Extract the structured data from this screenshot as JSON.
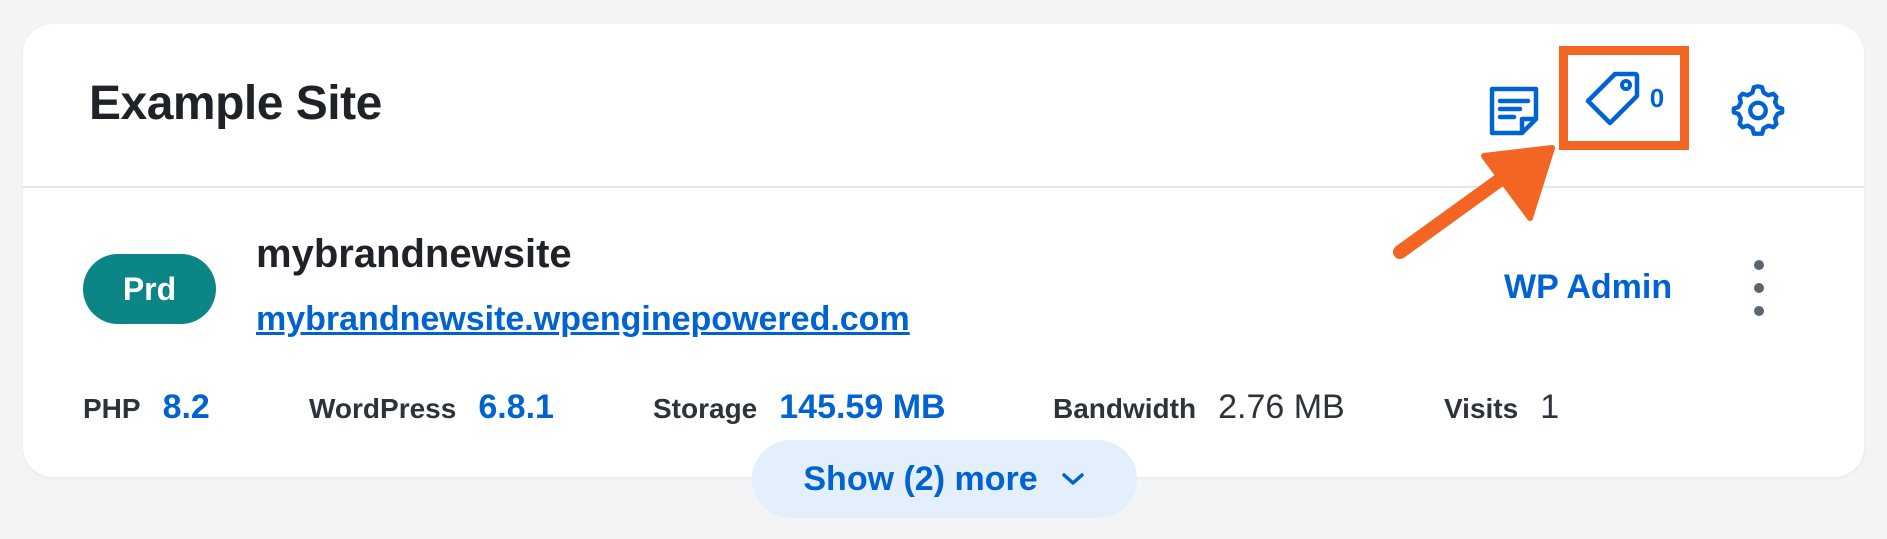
{
  "site": {
    "title": "Example Site",
    "tag_count": "0"
  },
  "environment": {
    "badge": "Prd",
    "name": "mybrandnewsite",
    "url": "mybrandnewsite.wpenginepowered.com",
    "wp_admin_label": "WP Admin"
  },
  "stats": [
    {
      "label": "PHP",
      "value": "8.2"
    },
    {
      "label": "WordPress",
      "value": "6.8.1"
    },
    {
      "label": "Storage",
      "value": "145.59 MB"
    },
    {
      "label": "Bandwidth",
      "value": "2.76 MB"
    },
    {
      "label": "Visits",
      "value": "1"
    }
  ],
  "show_more_label": "Show (2) more",
  "icons": {
    "notes": "notes-icon",
    "tags": "tag-icon",
    "settings": "gear-icon",
    "menu": "more-vertical-icon",
    "expand": "chevron-down-icon",
    "annotation": "arrow-icon"
  },
  "colors": {
    "accent": "#0063d1",
    "badge": "#0b8586",
    "highlight": "#f26522",
    "page_bg": "#f3f4f6"
  }
}
